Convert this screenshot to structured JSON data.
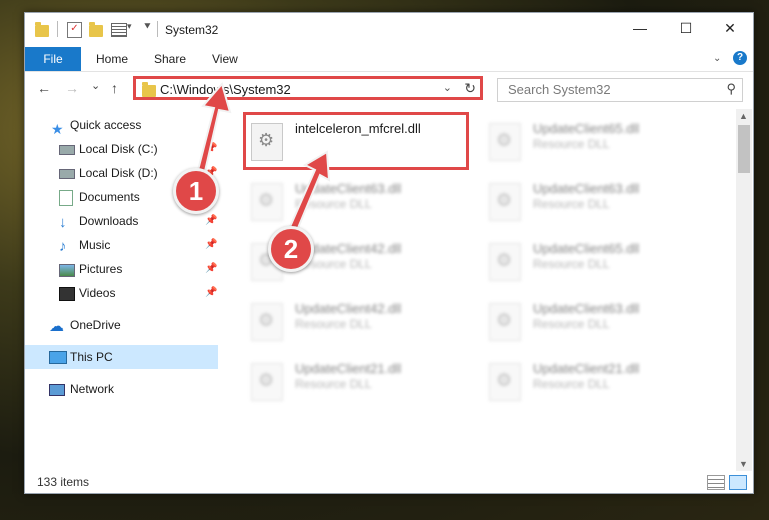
{
  "window": {
    "title": "System32",
    "buttons": {
      "minimize": "—",
      "maximize": "☐",
      "close": "✕"
    }
  },
  "ribbon": {
    "tabs": [
      "File",
      "Home",
      "Share",
      "View"
    ],
    "help": "?"
  },
  "navbar": {
    "back": "←",
    "forward": "→",
    "recent": "⌄",
    "up": "↑",
    "path": "C:\\Windows\\System32",
    "search_placeholder": "Search System32"
  },
  "sidebar": {
    "items": [
      {
        "label": "Quick access",
        "icon": "star-icon",
        "pinned": false
      },
      {
        "label": "Local Disk (C:)",
        "icon": "drive-icon",
        "pinned": true
      },
      {
        "label": "Local Disk (D:)",
        "icon": "drive-icon",
        "pinned": true
      },
      {
        "label": "Documents",
        "icon": "documents-icon",
        "pinned": true
      },
      {
        "label": "Downloads",
        "icon": "downloads-icon",
        "pinned": true
      },
      {
        "label": "Music",
        "icon": "music-icon",
        "pinned": true
      },
      {
        "label": "Pictures",
        "icon": "pictures-icon",
        "pinned": true
      },
      {
        "label": "Videos",
        "icon": "videos-icon",
        "pinned": true
      },
      {
        "label": "OneDrive",
        "icon": "cloud-icon",
        "pinned": false
      },
      {
        "label": "This PC",
        "icon": "computer-icon",
        "pinned": false,
        "selected": true
      },
      {
        "label": "Network",
        "icon": "network-icon",
        "pinned": false
      }
    ]
  },
  "files": [
    {
      "name": "intelceleron_mfcrel.dll",
      "type": "",
      "highlighted": true
    },
    {
      "name": "UpdateClient65.dll",
      "type": "Resource DLL"
    },
    {
      "name": "UpdateClient63.dll",
      "type": "Resource DLL"
    },
    {
      "name": "UpdateClient63.dll",
      "type": "Resource DLL"
    },
    {
      "name": "UpdateClient42.dll",
      "type": "Resource DLL"
    },
    {
      "name": "UpdateClient65.dll",
      "type": "Resource DLL"
    },
    {
      "name": "UpdateClient42.dll",
      "type": "Resource DLL"
    },
    {
      "name": "UpdateClient63.dll",
      "type": "Resource DLL"
    },
    {
      "name": "UpdateClient21.dll",
      "type": "Resource DLL"
    },
    {
      "name": "UpdateClient21.dll",
      "type": "Resource DLL"
    }
  ],
  "status": {
    "count": "133 items"
  },
  "annotations": {
    "step1": "1",
    "step2": "2"
  },
  "colors": {
    "accent": "#1979ca",
    "highlight": "#e04848",
    "selected": "#cce8ff"
  }
}
